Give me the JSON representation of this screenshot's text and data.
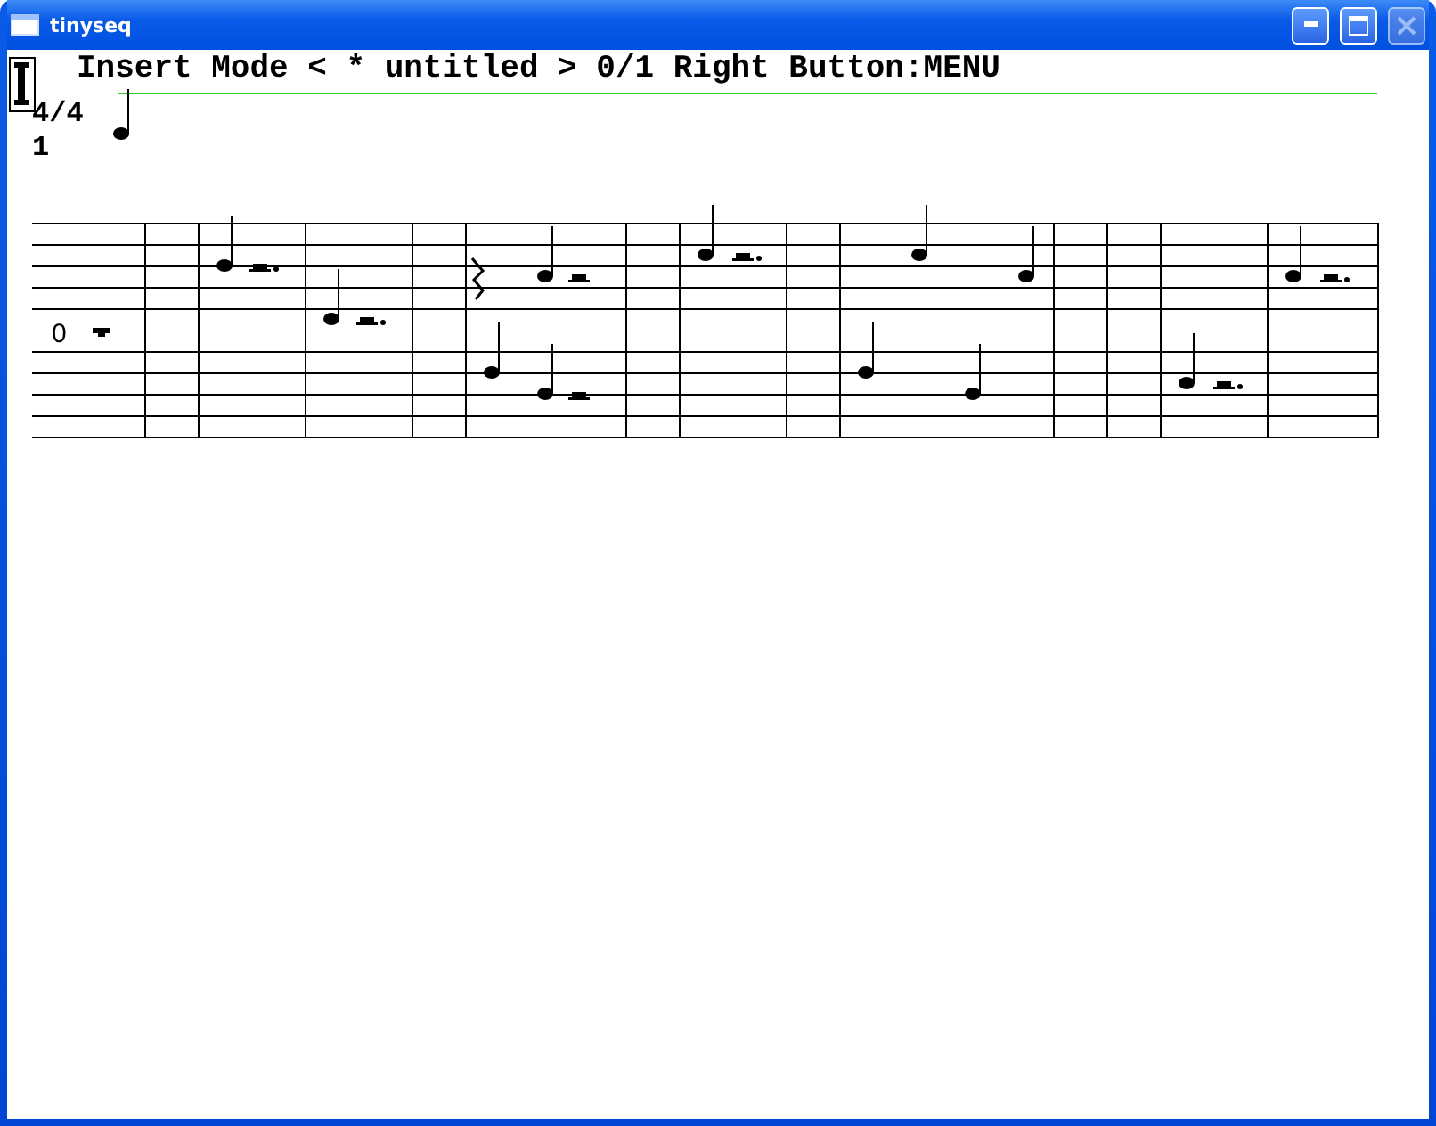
{
  "window": {
    "title": "tinyseq"
  },
  "title_buttons": [
    {
      "kind": "minimize",
      "disabled": false
    },
    {
      "kind": "maximize",
      "disabled": false
    },
    {
      "kind": "close",
      "disabled": true
    }
  ],
  "status": "Insert Mode < * untitled > 0/1 Right Button:MENU",
  "time_signature": "4/4",
  "measure_number": "1",
  "track_label": "0"
}
